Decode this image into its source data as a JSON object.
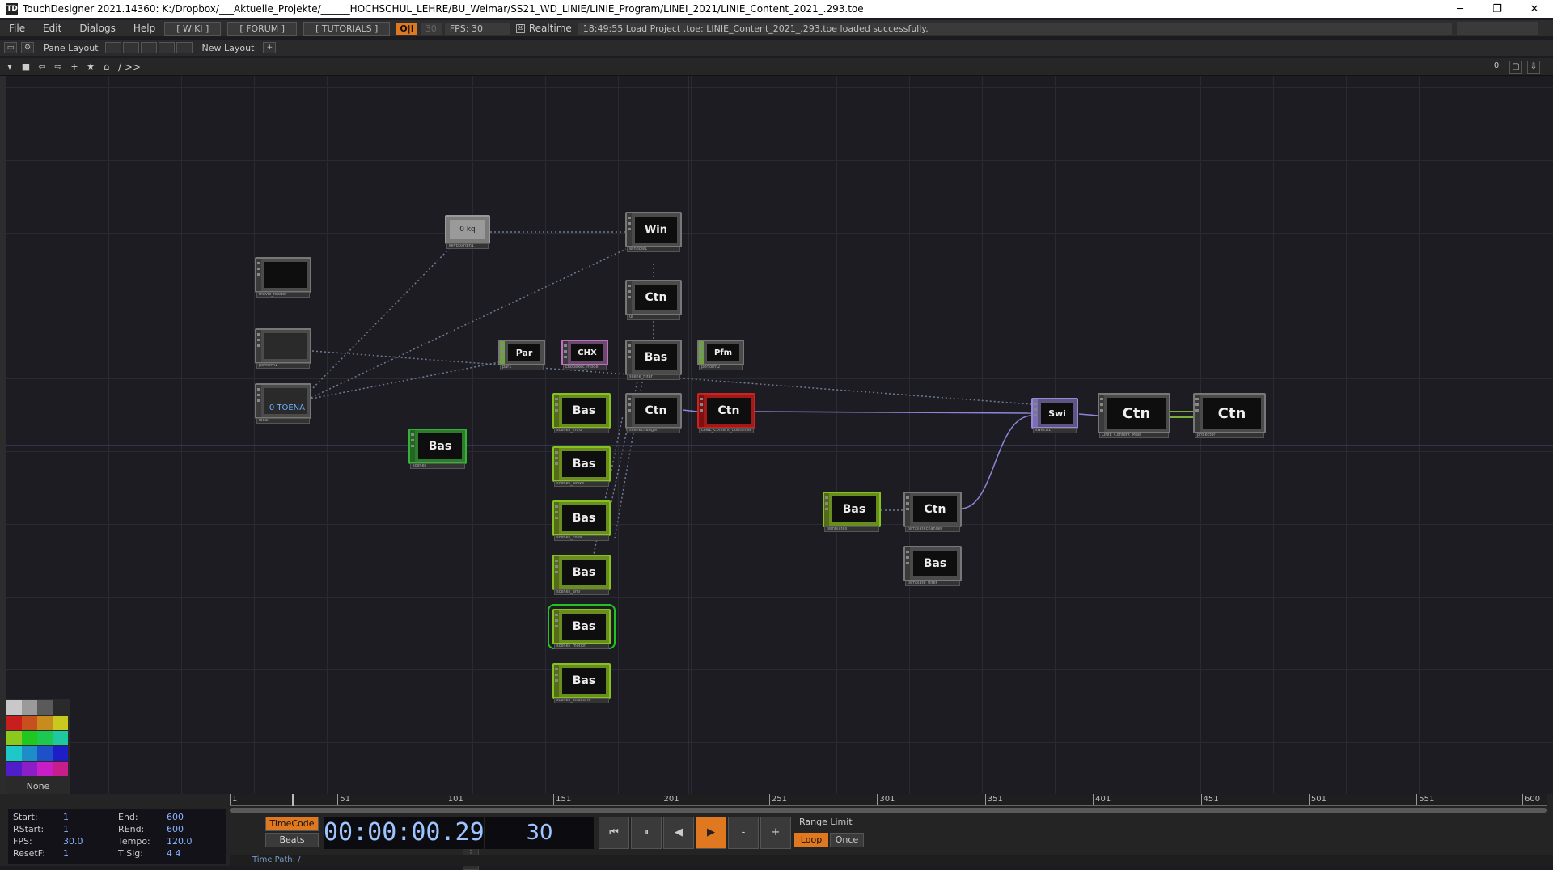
{
  "window": {
    "title": "TouchDesigner 2021.14360: K:/Dropbox/___Aktuelle_Projekte/______HOCHSCHUL_LEHRE/BU_Weimar/SS21_WD_LINIE/LINIE_Program/LINEI_2021/LINIE_Content_2021_.293.toe",
    "minimize": "─",
    "restore": "❐",
    "close": "✕"
  },
  "menu": {
    "items": [
      "File",
      "Edit",
      "Dialogs",
      "Help"
    ],
    "wiki": "[ WIKI ]",
    "forum": "[ FORUM ]",
    "tutorials": "[ TUTORIALS ]",
    "perform": "O|I",
    "fps_cook": "30",
    "fps_label": "FPS:  30",
    "realtime_check": "☒",
    "realtime": "Realtime",
    "status": "18:49:55 Load Project .toe: LINIE_Content_2021_.293.toe loaded successfully."
  },
  "panebar": {
    "pane_layout": "Pane Layout",
    "new_layout": "New Layout",
    "add": "+"
  },
  "pathbar": {
    "path": "/  >>",
    "right_value": "0"
  },
  "nodes": [
    {
      "label": "0 kq",
      "cap": "keyboardin1"
    },
    {
      "label": "Win",
      "cap": "window1"
    },
    {
      "label": "Ctn",
      "cap": "ui"
    },
    {
      "label": "",
      "cap": "movie_reader"
    },
    {
      "label": "",
      "cap": "perform1"
    },
    {
      "label": "0  TOENA",
      "cap": "local"
    },
    {
      "label": "Par",
      "cap": "par1"
    },
    {
      "label": "CHX",
      "cap": "chopexec_mode"
    },
    {
      "label": "Bas",
      "cap": "scene_filter"
    },
    {
      "label": "Pfm",
      "cap": "perform2"
    },
    {
      "label": "Bas",
      "cap": "scenes_intro"
    },
    {
      "label": "Ctn",
      "cap": "scenechanger"
    },
    {
      "label": "Ctn",
      "cap": "LINIE_Content_Container"
    },
    {
      "label": "Bas",
      "cap": "scenes"
    },
    {
      "label": "Bas",
      "cap": "scenes_wolke"
    },
    {
      "label": "Bas",
      "cap": "scenes_color"
    },
    {
      "label": "Bas",
      "cap": "scenes_ami"
    },
    {
      "label": "Bas",
      "cap": "scenes_motion"
    },
    {
      "label": "Bas",
      "cap": "scenes_structure"
    },
    {
      "label": "Swi",
      "cap": "switch1"
    },
    {
      "label": "Ctn",
      "cap": "LINIE_Content_Main"
    },
    {
      "label": "Ctn",
      "cap": "projector"
    },
    {
      "label": "Bas",
      "cap": "templates"
    },
    {
      "label": "Ctn",
      "cap": "templatechanger"
    },
    {
      "label": "Bas",
      "cap": "template_filter"
    }
  ],
  "palette": {
    "colors": [
      "#c8c8c8",
      "#9a9a9a",
      "#5a5a5a",
      "#2a2a2a",
      "#c81e1e",
      "#c8501e",
      "#c88c1e",
      "#c8c81e",
      "#8cc81e",
      "#1ec81e",
      "#1ec850",
      "#1ec8a0",
      "#1ec8c8",
      "#1e8cc8",
      "#1e50c8",
      "#1e1ec8",
      "#501ec8",
      "#8c1ec8",
      "#c81ec8",
      "#c81e8c"
    ],
    "none": "None"
  },
  "timeline": {
    "ticks": [
      "1",
      "51",
      "101",
      "151",
      "201",
      "251",
      "301",
      "351",
      "401",
      "451",
      "501",
      "551",
      "600"
    ],
    "info": [
      {
        "k": "Start:",
        "v": "1",
        "k2": "End:",
        "v2": "600"
      },
      {
        "k": "RStart:",
        "v": "1",
        "k2": "REnd:",
        "v2": "600"
      },
      {
        "k": "FPS:",
        "v": "30.0",
        "k2": "Tempo:",
        "v2": "120.0"
      },
      {
        "k": "ResetF:",
        "v": "1",
        "k2": "T Sig:",
        "v2": "4      4"
      }
    ],
    "timecode_btn": "TimeCode",
    "beats_btn": "Beats",
    "timecode": "00:00:00.29",
    "frame": "30",
    "btn_rewind": "⏮",
    "btn_pause": "⏸",
    "btn_back": "◀",
    "btn_play": "▶",
    "btn_minus": "-",
    "btn_plus": "+",
    "range_limit": "Range Limit",
    "loop": "Loop",
    "once": "Once",
    "time_path": "Time Path: /",
    "playhead_frame": 30
  }
}
